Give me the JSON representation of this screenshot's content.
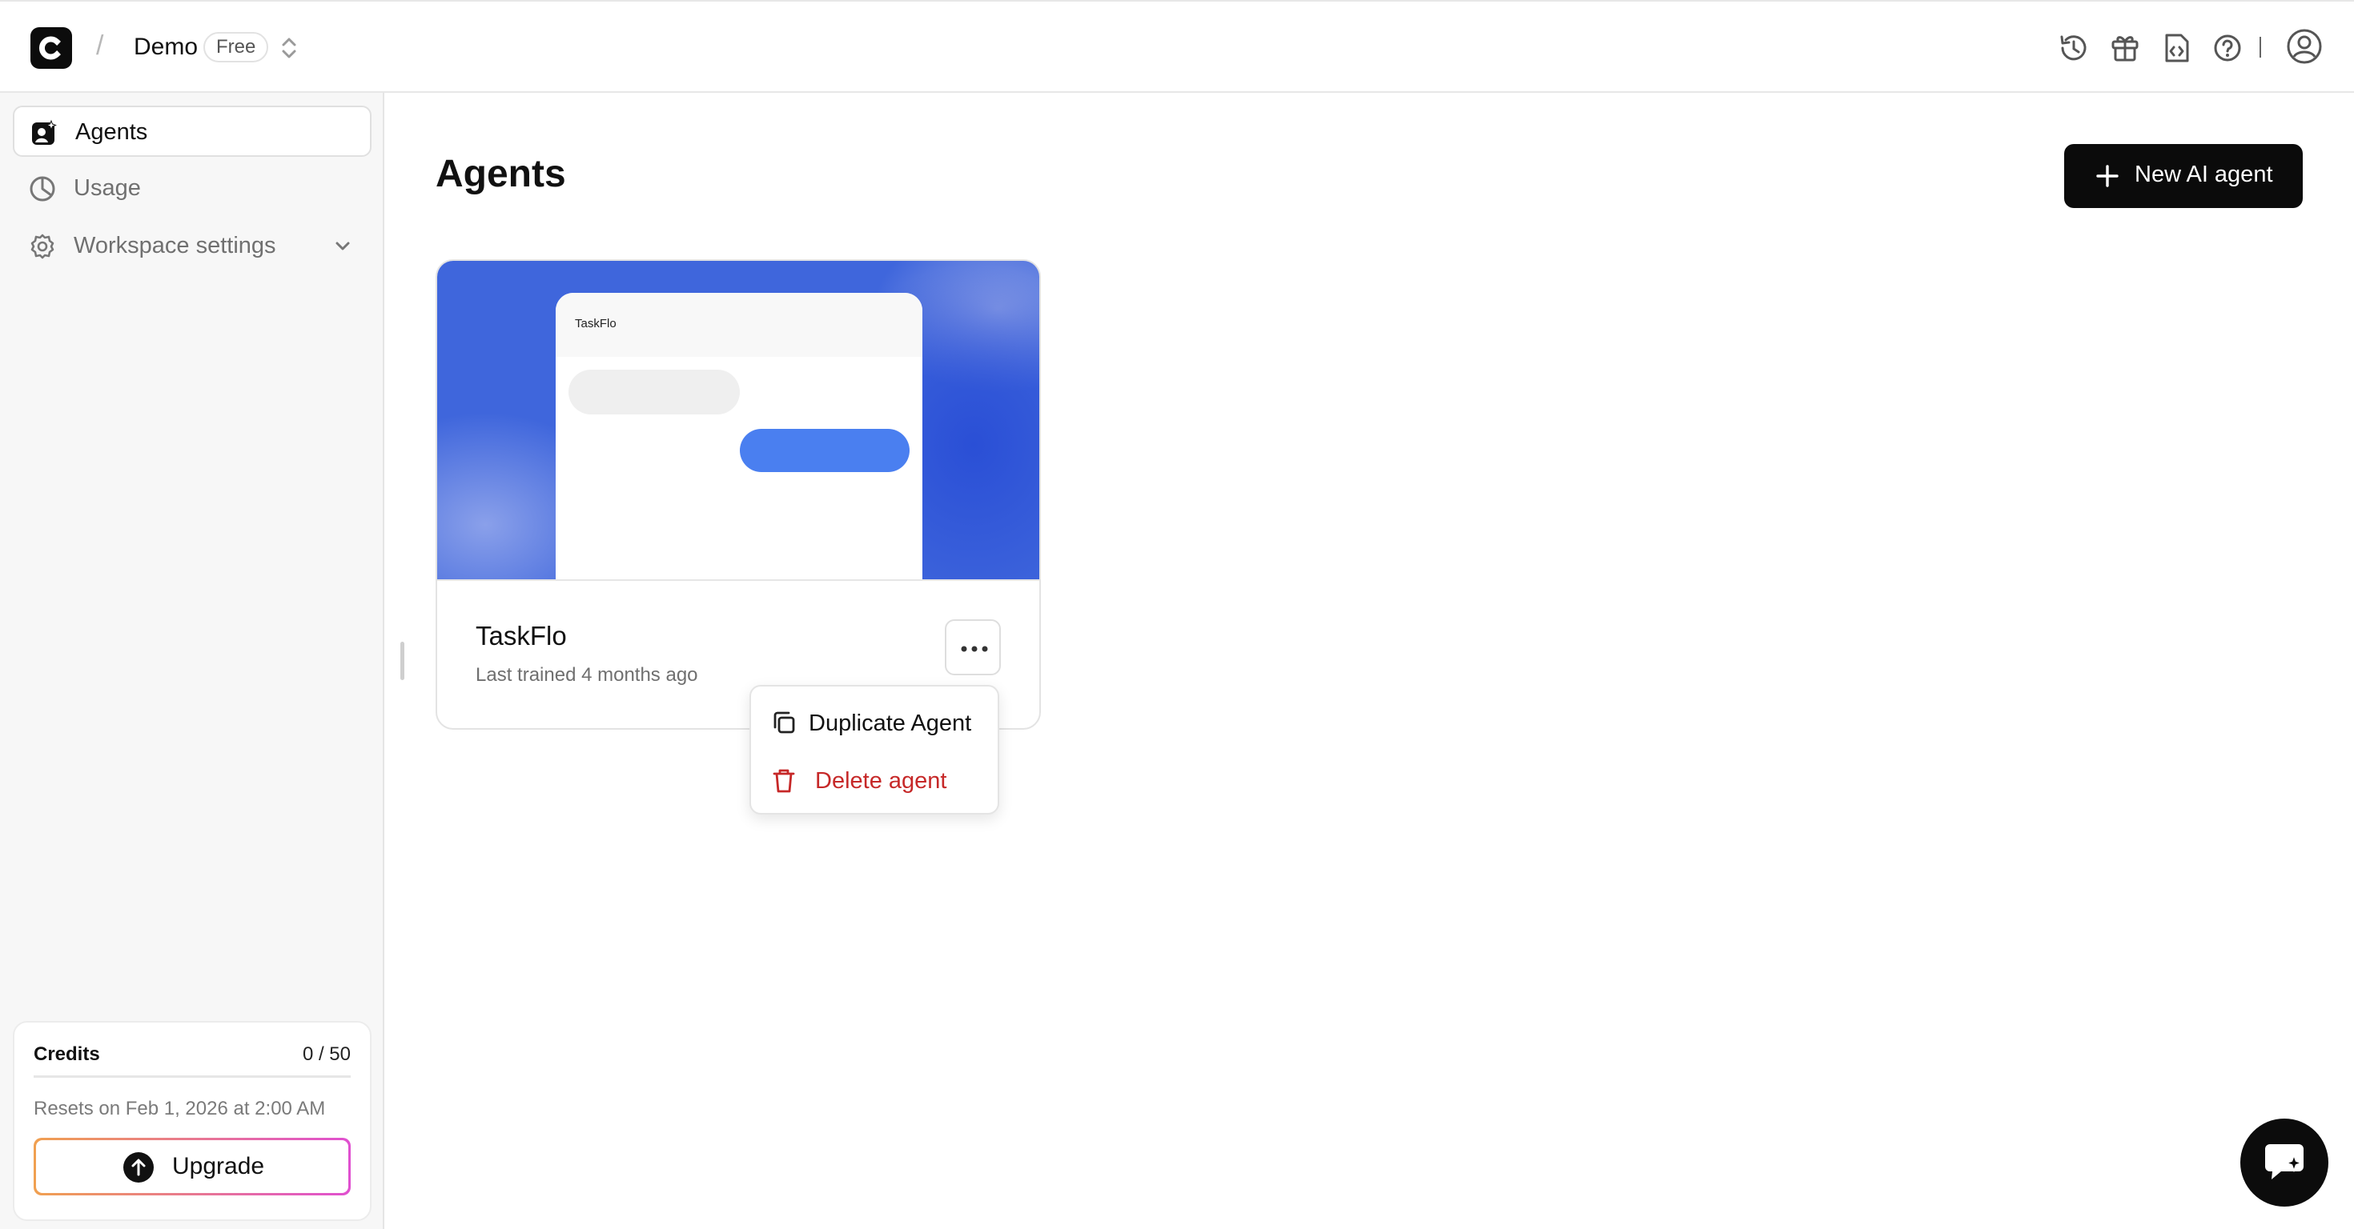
{
  "header": {
    "workspace_name": "Demo",
    "plan_badge": "Free",
    "separator": "/",
    "icons": [
      "history-icon",
      "gift-icon",
      "code-docs-icon",
      "help-icon",
      "account-icon"
    ]
  },
  "sidebar": {
    "items": [
      {
        "label": "Agents",
        "icon": "agents-icon",
        "active": true
      },
      {
        "label": "Usage",
        "icon": "pie-chart-icon",
        "active": false
      },
      {
        "label": "Workspace settings",
        "icon": "gear-icon",
        "active": false
      }
    ],
    "credits": {
      "title": "Credits",
      "count": "0 / 50",
      "used_fraction": 0,
      "reset_text": "Resets on Feb 1, 2026 at 2:00 AM",
      "upgrade_label": "Upgrade"
    }
  },
  "main": {
    "title": "Agents",
    "new_agent_label": "New AI agent",
    "agents": [
      {
        "name": "TaskFlo",
        "preview_title": "TaskFlo",
        "meta": "Last trained 4 months ago"
      }
    ],
    "menu": {
      "items": [
        {
          "label": "Duplicate Agent",
          "icon": "copy-icon"
        },
        {
          "label": "Delete agent",
          "icon": "trash-icon",
          "color": "#c62828"
        }
      ]
    }
  },
  "colors": {
    "accent": "#0b0b0b",
    "cover_blue": "#3f66dc",
    "bubble_blue": "#4a7ff0",
    "danger": "#c62828"
  }
}
